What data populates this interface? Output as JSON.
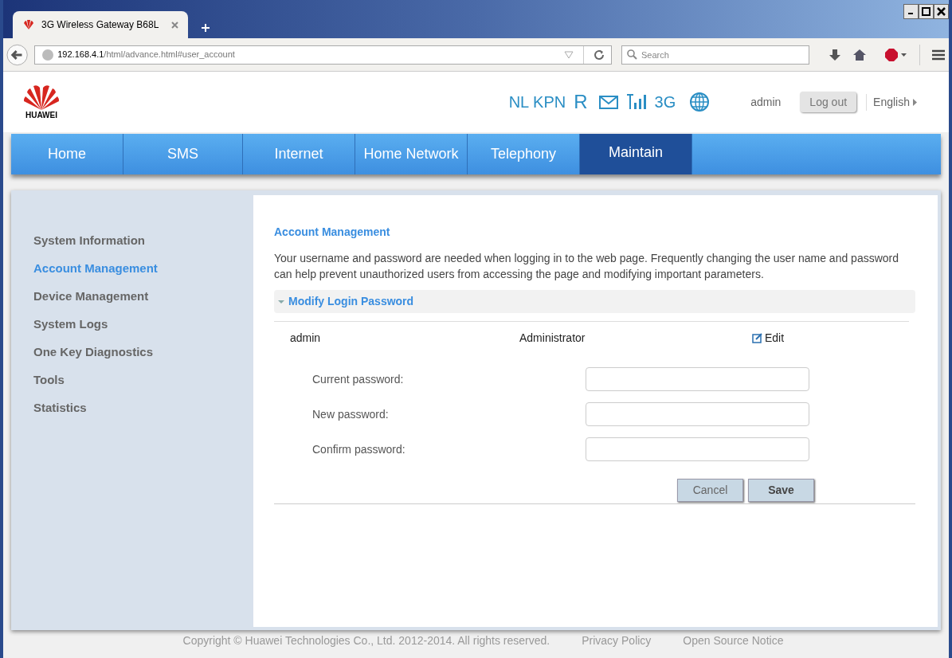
{
  "browser": {
    "tab_title": "3G Wireless Gateway B68L",
    "url_host": "192.168.4.1",
    "url_path": "/html/advance.html#user_account",
    "search_placeholder": "Search"
  },
  "header": {
    "logo_text": "HUAWEI",
    "operator": "NL KPN",
    "roaming": "R",
    "network_type": "3G",
    "user": "admin",
    "logout": "Log out",
    "language": "English"
  },
  "nav": [
    {
      "label": "Home",
      "selected": false
    },
    {
      "label": "SMS",
      "selected": false
    },
    {
      "label": "Internet",
      "selected": false
    },
    {
      "label": "Home Network",
      "selected": false
    },
    {
      "label": "Telephony",
      "selected": false
    },
    {
      "label": "Maintain",
      "selected": true
    }
  ],
  "sidebar": [
    {
      "label": "System Information",
      "selected": false
    },
    {
      "label": "Account Management",
      "selected": true
    },
    {
      "label": "Device Management",
      "selected": false
    },
    {
      "label": "System Logs",
      "selected": false
    },
    {
      "label": "One Key Diagnostics",
      "selected": false
    },
    {
      "label": "Tools",
      "selected": false
    },
    {
      "label": "Statistics",
      "selected": false
    }
  ],
  "content": {
    "title": "Account Management",
    "description": "Your username and password are needed when logging in to the web page. Frequently changing the user name and password can help prevent unauthorized users from accessing the page and modifying important parameters.",
    "panel": {
      "title": "Modify Login Password",
      "expanded": true,
      "account": {
        "user": "admin",
        "role": "Administrator",
        "edit": "Edit"
      },
      "fields": [
        {
          "label": "Current password:"
        },
        {
          "label": "New password:"
        },
        {
          "label": "Confirm password:"
        }
      ],
      "buttons": [
        {
          "label": "Cancel",
          "kind": "secondary"
        },
        {
          "label": "Save",
          "kind": "primary"
        }
      ]
    }
  },
  "footer": {
    "copyright": "Copyright © Huawei Technologies Co., Ltd. 2012-2014. All rights reserved.",
    "links": [
      "Privacy Policy",
      "Open Source Notice"
    ]
  }
}
